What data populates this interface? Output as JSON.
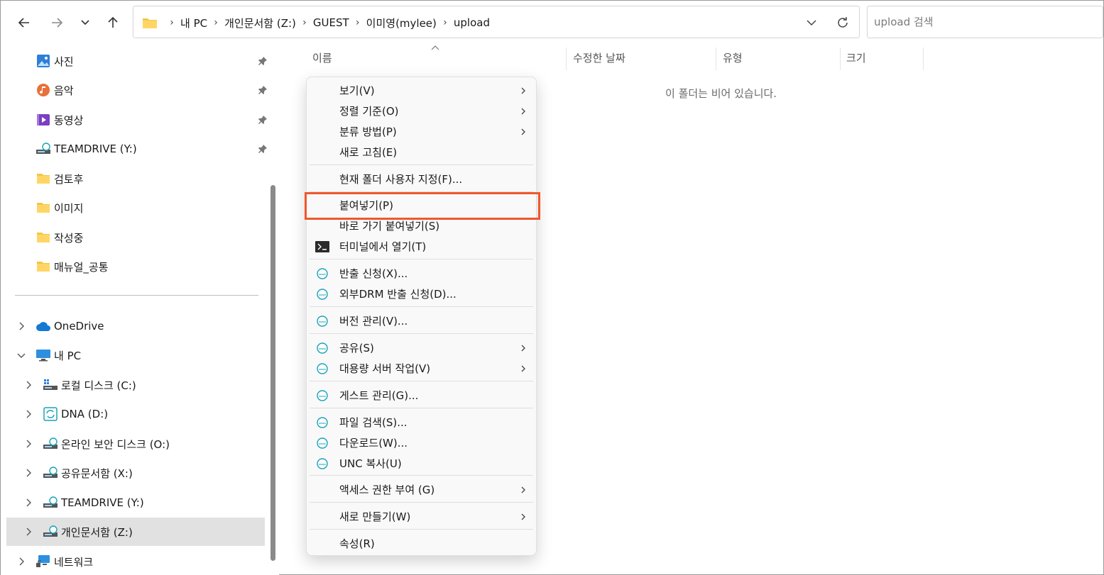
{
  "nav": {
    "back_icon": "arrow-left-icon",
    "forward_icon": "arrow-right-icon",
    "recent_icon": "chevron-down-icon",
    "up_icon": "arrow-up-icon"
  },
  "address": {
    "crumbs": [
      "내 PC",
      "개인문서함 (Z:)",
      "GUEST",
      "이미영(mylee)",
      "upload"
    ]
  },
  "search": {
    "placeholder": "upload 검색"
  },
  "sidebar": {
    "quick": [
      {
        "label": "사진",
        "icon": "pictures-icon",
        "pinned": true
      },
      {
        "label": "음악",
        "icon": "music-icon",
        "pinned": true
      },
      {
        "label": "동영상",
        "icon": "videos-icon",
        "pinned": true
      },
      {
        "label": "TEAMDRIVE (Y:)",
        "icon": "network-drive-icon",
        "pinned": true
      },
      {
        "label": "검토후",
        "icon": "folder-icon",
        "pinned": false
      },
      {
        "label": "이미지",
        "icon": "folder-icon",
        "pinned": false
      },
      {
        "label": "작성중",
        "icon": "folder-icon",
        "pinned": false
      },
      {
        "label": "매뉴얼_공통",
        "icon": "folder-icon",
        "pinned": false
      }
    ],
    "tree": [
      {
        "label": "OneDrive",
        "icon": "cloud-icon",
        "level": 0,
        "expanded": false
      },
      {
        "label": "내 PC",
        "icon": "computer-icon",
        "level": 0,
        "expanded": true
      },
      {
        "label": "로컬 디스크 (C:)",
        "icon": "local-disk-icon",
        "level": 1,
        "expanded": false
      },
      {
        "label": "DNA (D:)",
        "icon": "sync-drive-icon",
        "level": 1,
        "expanded": false
      },
      {
        "label": "온라인 보안 디스크 (O:)",
        "icon": "network-drive-icon",
        "level": 1,
        "expanded": false
      },
      {
        "label": "공유문서함 (X:)",
        "icon": "network-drive-icon",
        "level": 1,
        "expanded": false
      },
      {
        "label": "TEAMDRIVE (Y:)",
        "icon": "network-drive-icon",
        "level": 1,
        "expanded": false
      },
      {
        "label": "개인문서함 (Z:)",
        "icon": "network-drive-icon",
        "level": 1,
        "expanded": false,
        "selected": true
      },
      {
        "label": "네트워크",
        "icon": "network-icon",
        "level": 0,
        "expanded": false
      }
    ]
  },
  "columns": {
    "name": "이름",
    "date": "수정한 날짜",
    "type": "유형",
    "size": "크기"
  },
  "empty_message": "이 폴더는 비어 있습니다.",
  "context_menu": {
    "items": [
      {
        "label": "보기(V)",
        "submenu": true
      },
      {
        "label": "정렬 기준(O)",
        "submenu": true
      },
      {
        "label": "분류 방법(P)",
        "submenu": true
      },
      {
        "label": "새로 고침(E)",
        "submenu": false
      },
      {
        "label": "현재 폴더 사용자 지정(F)...",
        "submenu": false
      },
      {
        "label": "붙여넣기(P)",
        "submenu": false,
        "highlighted": true
      },
      {
        "label": "바로 가기 붙여넣기(S)",
        "submenu": false
      },
      {
        "label": "터미널에서 열기(T)",
        "submenu": false,
        "icon": "terminal-icon"
      },
      {
        "label": "반출 신청(X)...",
        "submenu": false,
        "icon": "doc-icon"
      },
      {
        "label": "외부DRM 반출 신청(D)...",
        "submenu": false,
        "icon": "doc-icon"
      },
      {
        "label": "버전 관리(V)...",
        "submenu": false,
        "icon": "doc-icon"
      },
      {
        "label": "공유(S)",
        "submenu": true,
        "icon": "doc-icon"
      },
      {
        "label": "대용량 서버 작업(V)",
        "submenu": true,
        "icon": "doc-icon"
      },
      {
        "label": "게스트 관리(G)...",
        "submenu": false,
        "icon": "doc-icon"
      },
      {
        "label": "파일 검색(S)...",
        "submenu": false,
        "icon": "doc-icon"
      },
      {
        "label": "다운로드(W)...",
        "submenu": false,
        "icon": "doc-icon"
      },
      {
        "label": "UNC 복사(U)",
        "submenu": false,
        "icon": "doc-icon"
      },
      {
        "label": "액세스 권한 부여 (G)",
        "submenu": true
      },
      {
        "label": "새로 만들기(W)",
        "submenu": true
      },
      {
        "label": "속성(R)",
        "submenu": false
      }
    ]
  },
  "colors": {
    "highlight_border": "#f0572c",
    "selected_bg": "#e1e1e1",
    "folder": "#f5c542"
  }
}
